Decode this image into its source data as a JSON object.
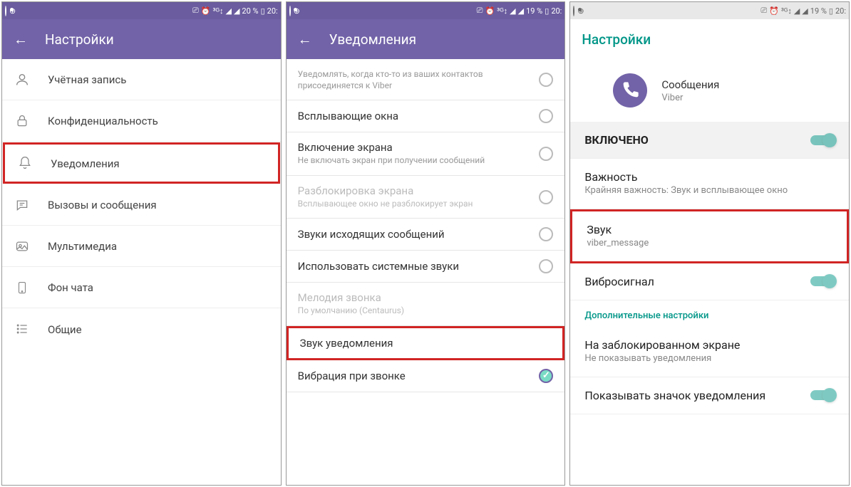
{
  "status1": {
    "battery": "20 %",
    "time": "20:"
  },
  "status2": {
    "battery": "19 %",
    "time": "20:"
  },
  "status3": {
    "battery": "19 %",
    "time": "20:"
  },
  "screen1": {
    "title": "Настройки",
    "items": [
      "Учётная запись",
      "Конфиденциальность",
      "Уведомления",
      "Вызовы и сообщения",
      "Мультимедиа",
      "Фон чата",
      "Общие"
    ]
  },
  "screen2": {
    "title": "Уведомления",
    "row0": {
      "t": "",
      "s": "Уведомлять, когда кто-то из ваших контактов присоединяется к Viber"
    },
    "row1": {
      "t": "Всплывающие окна"
    },
    "row2": {
      "t": "Включение экрана",
      "s": "Не включать экран при получении сообщений"
    },
    "row3": {
      "t": "Разблокировка экрана",
      "s": "Всплывающее окно не разблокирует экран"
    },
    "row4": {
      "t": "Звуки исходящих сообщений"
    },
    "row5": {
      "t": "Использовать системные звуки"
    },
    "row6": {
      "t": "Мелодия звонка",
      "s": "По умолчанию (Centaurus)"
    },
    "row7": {
      "t": "Звук уведомления"
    },
    "row8": {
      "t": "Вибрация при звонке"
    }
  },
  "screen3": {
    "title": "Настройки",
    "app": {
      "t": "Сообщения",
      "s": "Viber"
    },
    "enabled": "ВКЛЮЧЕНО",
    "importance": {
      "t": "Важность",
      "s": "Крайняя важность: Звук и всплывающее окно"
    },
    "sound": {
      "t": "Звук",
      "s": "viber_message"
    },
    "vibrate": "Вибросигнал",
    "section": "Дополнительные настройки",
    "lock": {
      "t": "На заблокированном экране",
      "s": "Не показывать уведомления"
    },
    "badge": "Показывать значок уведомления"
  }
}
